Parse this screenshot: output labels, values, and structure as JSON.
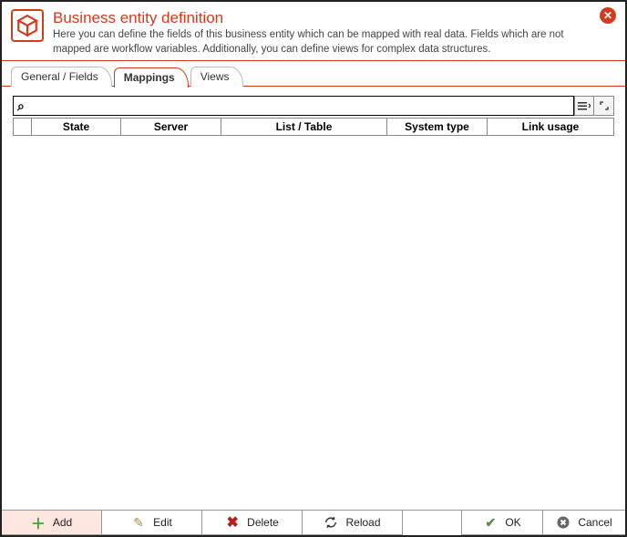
{
  "header": {
    "title": "Business entity definition",
    "subtitle": "Here you can define the fields of this business entity which can be mapped with real data. Fields which are not mapped are workflow variables. Additionally, you can define views for complex data structures."
  },
  "tabs": {
    "general": "General / Fields",
    "mappings": "Mappings",
    "views": "Views",
    "active": "mappings"
  },
  "search": {
    "placeholder": ""
  },
  "table": {
    "columns": {
      "state": "State",
      "server": "Server",
      "list": "List / Table",
      "systype": "System type",
      "link": "Link usage"
    },
    "rows": []
  },
  "buttons": {
    "add": "Add",
    "edit": "Edit",
    "delete": "Delete",
    "reload": "Reload",
    "ok": "OK",
    "cancel": "Cancel"
  }
}
